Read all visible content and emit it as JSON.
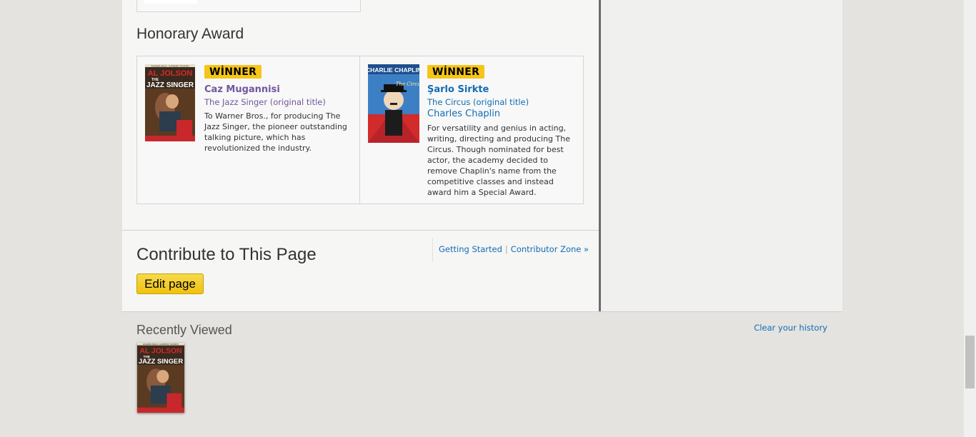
{
  "honorary": {
    "title": "Honorary Award",
    "entries": [
      {
        "badge": "WİNNER",
        "nominee": "Caz Mugannisi",
        "original_title": "The Jazz Singer (original title)",
        "description": "To Warner Bros., for producing The Jazz Singer, the pioneer outstanding talking picture, which has revolutionized the industry.",
        "poster_text": {
          "top": "WARNER BROS. SUPREME TRIUMPH",
          "line1": "AL JOLSON",
          "line2": "THE",
          "line3": "JAZZ SINGER"
        }
      },
      {
        "badge": "WİNNER",
        "nominee": "Şarlo Sirkte",
        "original_title": "The Circus (original title)",
        "person": "Charles Chaplin",
        "description": "For versatility and genius in acting, writing, directing and producing The Circus. Though nominated for best actor, the academy decided to remove Chaplin's name from the competitive classes and instead award him a Special Award.",
        "poster_text": {
          "line1": "CHARLIE CHAPLIN",
          "line2": "The Circus"
        }
      }
    ]
  },
  "contribute": {
    "title": "Contribute to This Page",
    "getting_started": "Getting Started",
    "separator": "|",
    "contributor_zone": "Contributor Zone »",
    "edit_button": "Edit page"
  },
  "recent": {
    "title": "Recently Viewed",
    "clear": "Clear your history"
  },
  "colors": {
    "badge": "#f5c518",
    "link": "#136cb2",
    "visited": "#70579d",
    "edit_button": "#f0c211"
  }
}
